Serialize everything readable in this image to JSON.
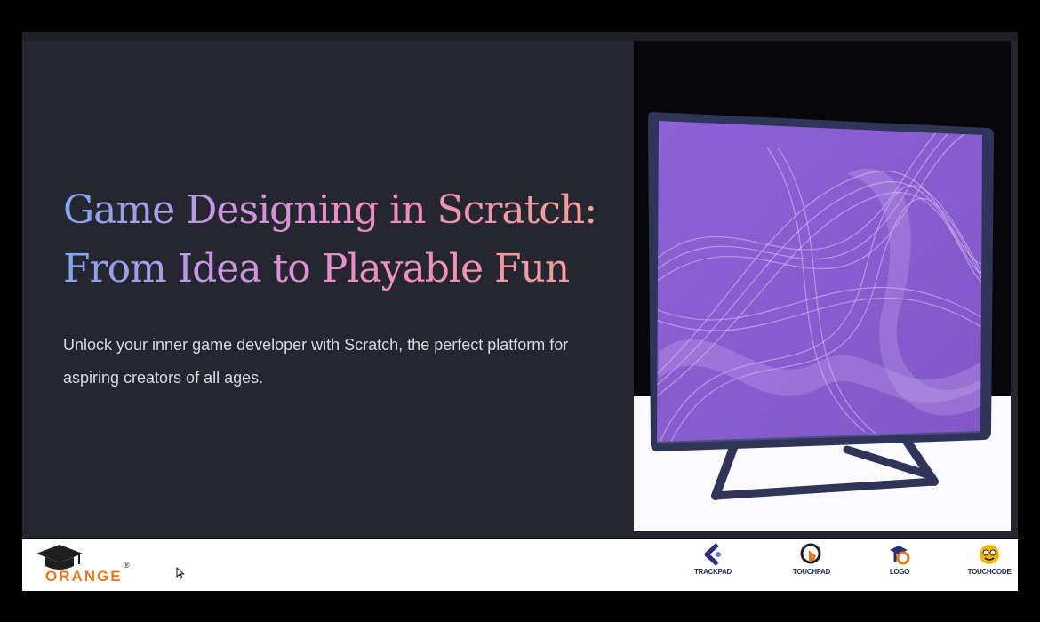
{
  "slide": {
    "title_lines": [
      "Game Designing in Scratch:",
      "From Idea to Playable Fun"
    ],
    "subtitle": "Unlock your inner game developer with Scratch, the perfect platform for aspiring creators of all ages."
  },
  "footer": {
    "brand": "ORANGE",
    "registered_mark": "®",
    "partners": [
      {
        "label": "TRACKPAD",
        "icon": "trackpad-logo-icon"
      },
      {
        "label": "TOUCHPAD",
        "icon": "touchpad-logo-icon"
      },
      {
        "label": "LOGO",
        "icon": "logo-brand-icon"
      },
      {
        "label": "TOUCHCODE",
        "icon": "touchcode-logo-icon"
      }
    ]
  },
  "colors": {
    "slide_bg": "#252630",
    "title_gradient": [
      "#7fa6ee",
      "#c896e6",
      "#ee8cc4",
      "#f4a08e"
    ],
    "screen_purple": "#8a5fd0",
    "monitor_frame": "#2e3558",
    "brand_orange": "#e8771d"
  }
}
